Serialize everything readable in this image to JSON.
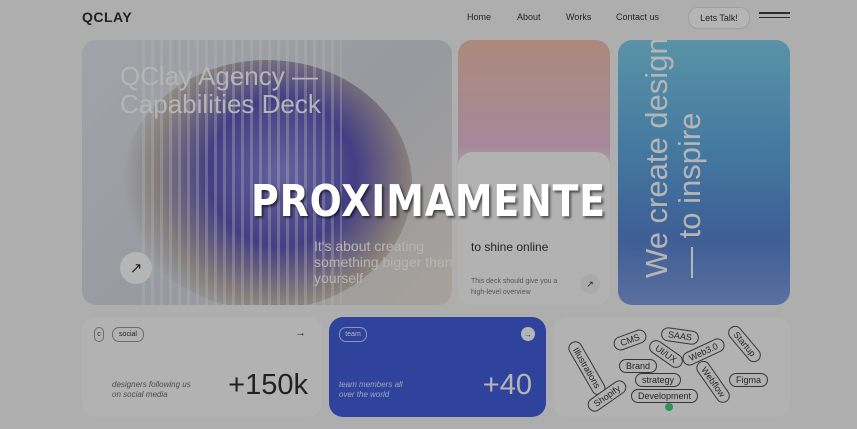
{
  "header": {
    "logo": "QCLAY",
    "nav": [
      "Home",
      "About",
      "Works",
      "Contact us"
    ],
    "cta": "Lets Talk!"
  },
  "hero": {
    "title_line1": "QClay Agency —",
    "title_line2": "Capabilities Deck",
    "subtitle": "It's about creating something bigger than yourself"
  },
  "mid_card": {
    "title": "to shine online",
    "text": "This deck should give you a high-level overview"
  },
  "blue_card": {
    "text_line1": "We create design",
    "text_line2": "— to inspire"
  },
  "stat_social": {
    "pill_partial": "c",
    "pill": "social",
    "label": "designers following us on social media",
    "value": "+150k"
  },
  "stat_team": {
    "pill": "team",
    "label": "team members all over the world",
    "value": "+40"
  },
  "tags": [
    "CMS",
    "SAAS",
    "UI/UX",
    "Web3.0",
    "Startup",
    "Brand",
    "strategy",
    "Illustrations",
    "Webflow",
    "Figma",
    "Shopify",
    "Development"
  ],
  "overlay_text": "PROXIMAMENTE"
}
